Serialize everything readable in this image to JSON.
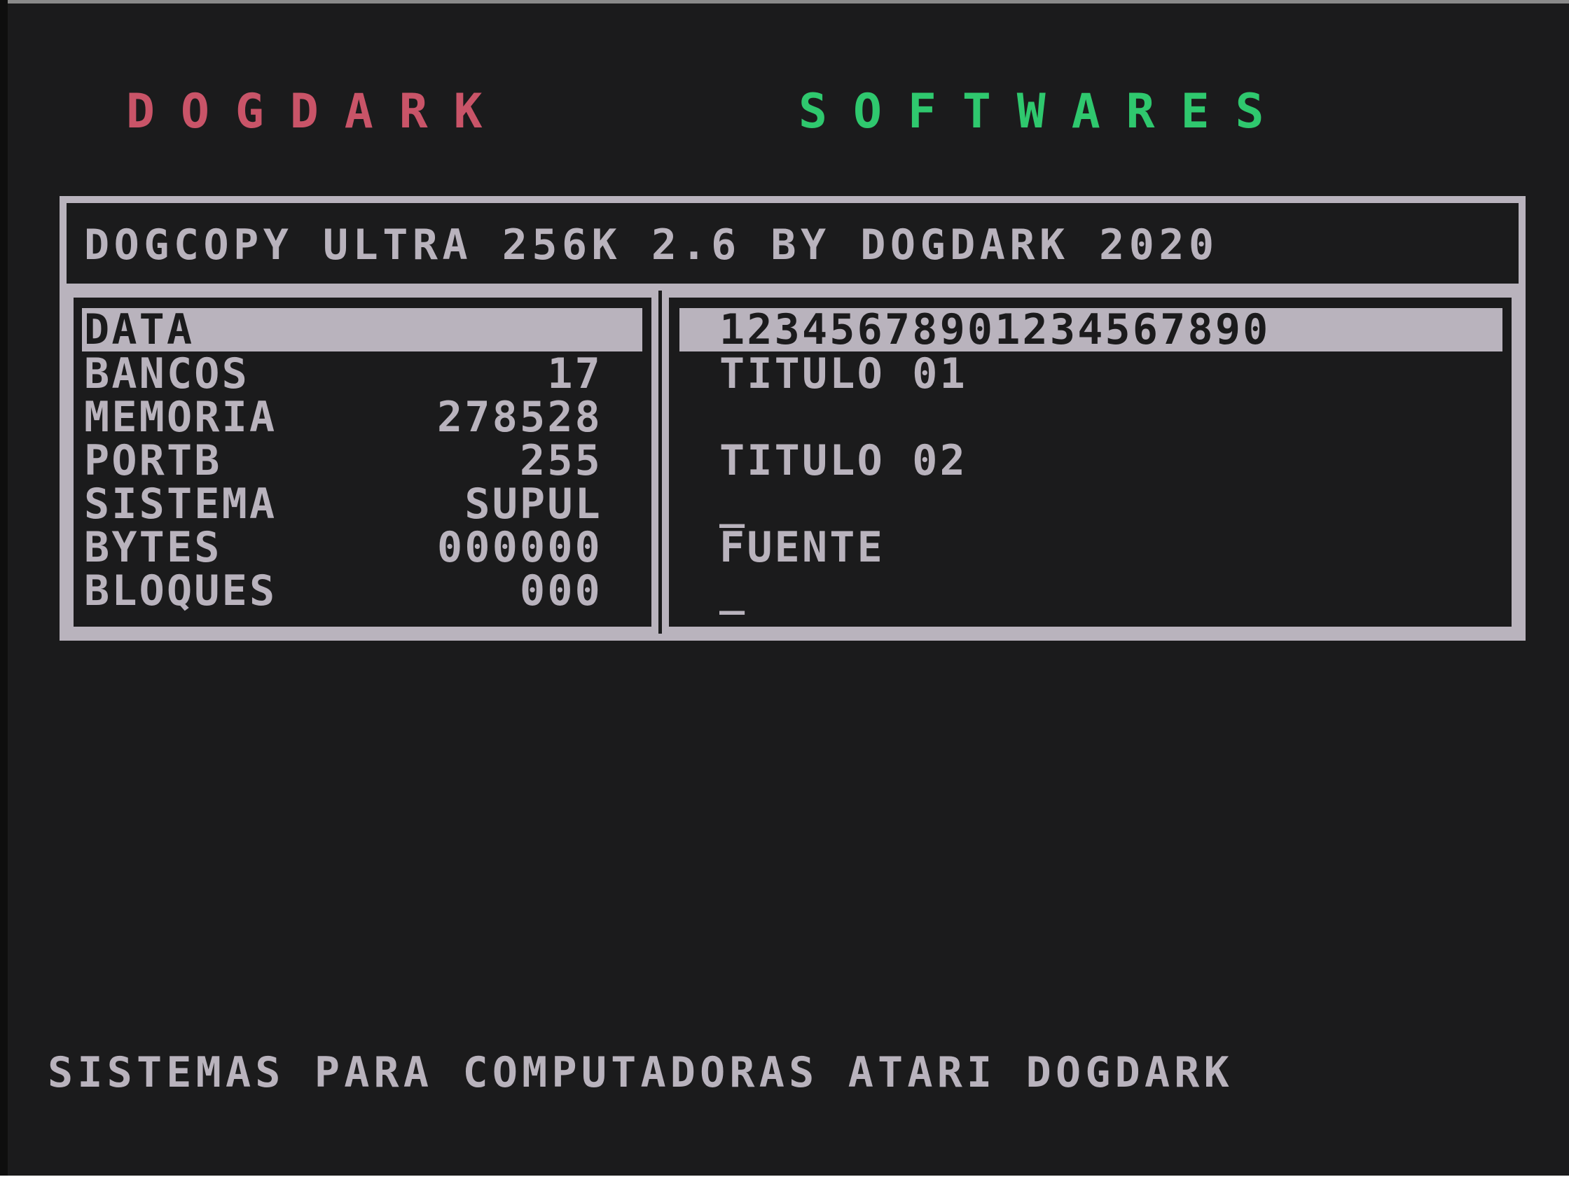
{
  "header": {
    "brand_left": "DOGDARK",
    "brand_right": "SOFTWARES",
    "brand_left_color": "#c95468",
    "brand_right_color": "#2fc86e"
  },
  "title_bar": {
    "text": "DOGCOPY ULTRA 256K 2.6 BY DOGDARK 2020"
  },
  "info_panel": {
    "selected": "DATA",
    "rows": [
      {
        "label": "BANCOS",
        "value": "17"
      },
      {
        "label": "MEMORIA",
        "value": "278528"
      },
      {
        "label": "PORTB",
        "value": "255"
      },
      {
        "label": "SISTEMA",
        "value": "SUPUL"
      },
      {
        "label": "BYTES",
        "value": "000000"
      },
      {
        "label": "BLOQUES",
        "value": "000"
      }
    ]
  },
  "edit_panel": {
    "ruler": "12345678901234567890",
    "title_01_label": "TITULO 01",
    "title_02_label": "TITULO 02",
    "title_02_cursor": "_",
    "fuente_label": "FUENTE",
    "fuente_cursor": "_"
  },
  "footer": {
    "text": "SISTEMAS PARA COMPUTADORAS ATARI DOGDARK"
  },
  "colors": {
    "background": "#1b1b1c",
    "foreground": "#b9b3bd"
  }
}
